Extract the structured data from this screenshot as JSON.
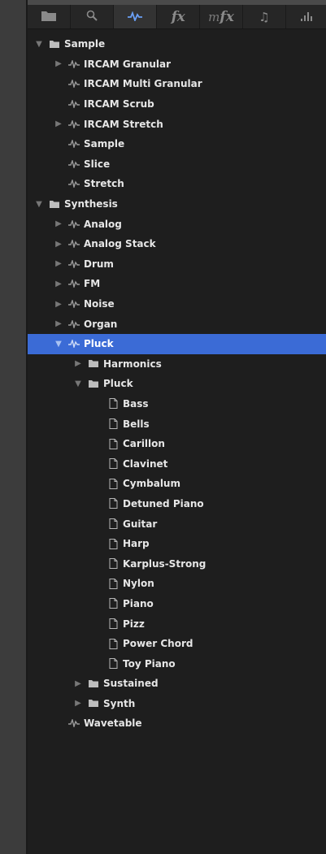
{
  "toolbar": {
    "tabs": [
      {
        "id": "folder",
        "icon": "folder-icon",
        "text": ""
      },
      {
        "id": "search",
        "icon": "search-icon",
        "text": ""
      },
      {
        "id": "instruments",
        "icon": "waveform-icon",
        "text": "",
        "active": true
      },
      {
        "id": "fx",
        "icon": "fx-icon",
        "text": "fx"
      },
      {
        "id": "mfx",
        "icon": "mfx-icon",
        "text_m": "m",
        "text_fx": "fx"
      },
      {
        "id": "notes",
        "icon": "music-note-icon",
        "text": "♫"
      },
      {
        "id": "levels",
        "icon": "level-bars-icon",
        "text": ""
      }
    ]
  },
  "tree": [
    {
      "level": 0,
      "arrow": "open",
      "icon": "folder",
      "label": "Sample"
    },
    {
      "level": 1,
      "arrow": "closed",
      "icon": "wave",
      "label": "IRCAM Granular"
    },
    {
      "level": 1,
      "arrow": "none",
      "icon": "wave",
      "label": "IRCAM Multi Granular"
    },
    {
      "level": 1,
      "arrow": "none",
      "icon": "wave",
      "label": "IRCAM Scrub"
    },
    {
      "level": 1,
      "arrow": "closed",
      "icon": "wave",
      "label": "IRCAM Stretch"
    },
    {
      "level": 1,
      "arrow": "none",
      "icon": "wave",
      "label": "Sample"
    },
    {
      "level": 1,
      "arrow": "none",
      "icon": "wave",
      "label": "Slice"
    },
    {
      "level": 1,
      "arrow": "none",
      "icon": "wave",
      "label": "Stretch"
    },
    {
      "level": 0,
      "arrow": "open",
      "icon": "folder",
      "label": "Synthesis"
    },
    {
      "level": 1,
      "arrow": "closed",
      "icon": "wave",
      "label": "Analog"
    },
    {
      "level": 1,
      "arrow": "closed",
      "icon": "wave",
      "label": "Analog Stack"
    },
    {
      "level": 1,
      "arrow": "closed",
      "icon": "wave",
      "label": "Drum"
    },
    {
      "level": 1,
      "arrow": "closed",
      "icon": "wave",
      "label": "FM"
    },
    {
      "level": 1,
      "arrow": "closed",
      "icon": "wave",
      "label": "Noise"
    },
    {
      "level": 1,
      "arrow": "closed",
      "icon": "wave",
      "label": "Organ"
    },
    {
      "level": 1,
      "arrow": "open",
      "icon": "wave",
      "label": "Pluck",
      "selected": true
    },
    {
      "level": 2,
      "arrow": "closed",
      "icon": "folder",
      "label": "Harmonics"
    },
    {
      "level": 2,
      "arrow": "open",
      "icon": "folder",
      "label": "Pluck"
    },
    {
      "level": 3,
      "arrow": "none",
      "icon": "file",
      "label": "Bass"
    },
    {
      "level": 3,
      "arrow": "none",
      "icon": "file",
      "label": "Bells"
    },
    {
      "level": 3,
      "arrow": "none",
      "icon": "file",
      "label": "Carillon"
    },
    {
      "level": 3,
      "arrow": "none",
      "icon": "file",
      "label": "Clavinet"
    },
    {
      "level": 3,
      "arrow": "none",
      "icon": "file",
      "label": "Cymbalum"
    },
    {
      "level": 3,
      "arrow": "none",
      "icon": "file",
      "label": "Detuned Piano"
    },
    {
      "level": 3,
      "arrow": "none",
      "icon": "file",
      "label": "Guitar"
    },
    {
      "level": 3,
      "arrow": "none",
      "icon": "file",
      "label": "Harp"
    },
    {
      "level": 3,
      "arrow": "none",
      "icon": "file",
      "label": "Karplus-Strong"
    },
    {
      "level": 3,
      "arrow": "none",
      "icon": "file",
      "label": "Nylon"
    },
    {
      "level": 3,
      "arrow": "none",
      "icon": "file",
      "label": "Piano"
    },
    {
      "level": 3,
      "arrow": "none",
      "icon": "file",
      "label": "Pizz"
    },
    {
      "level": 3,
      "arrow": "none",
      "icon": "file",
      "label": "Power Chord"
    },
    {
      "level": 3,
      "arrow": "none",
      "icon": "file",
      "label": "Toy Piano"
    },
    {
      "level": 2,
      "arrow": "closed",
      "icon": "folder",
      "label": "Sustained"
    },
    {
      "level": 2,
      "arrow": "closed",
      "icon": "folder",
      "label": "Synth"
    },
    {
      "level": 1,
      "arrow": "none",
      "icon": "wave",
      "label": "Wavetable"
    }
  ],
  "colors": {
    "selection": "#3b6bd6",
    "active_tab_icon": "#6a9ff5",
    "text": "#e6e6e6",
    "panel": "#1e1e1e"
  }
}
